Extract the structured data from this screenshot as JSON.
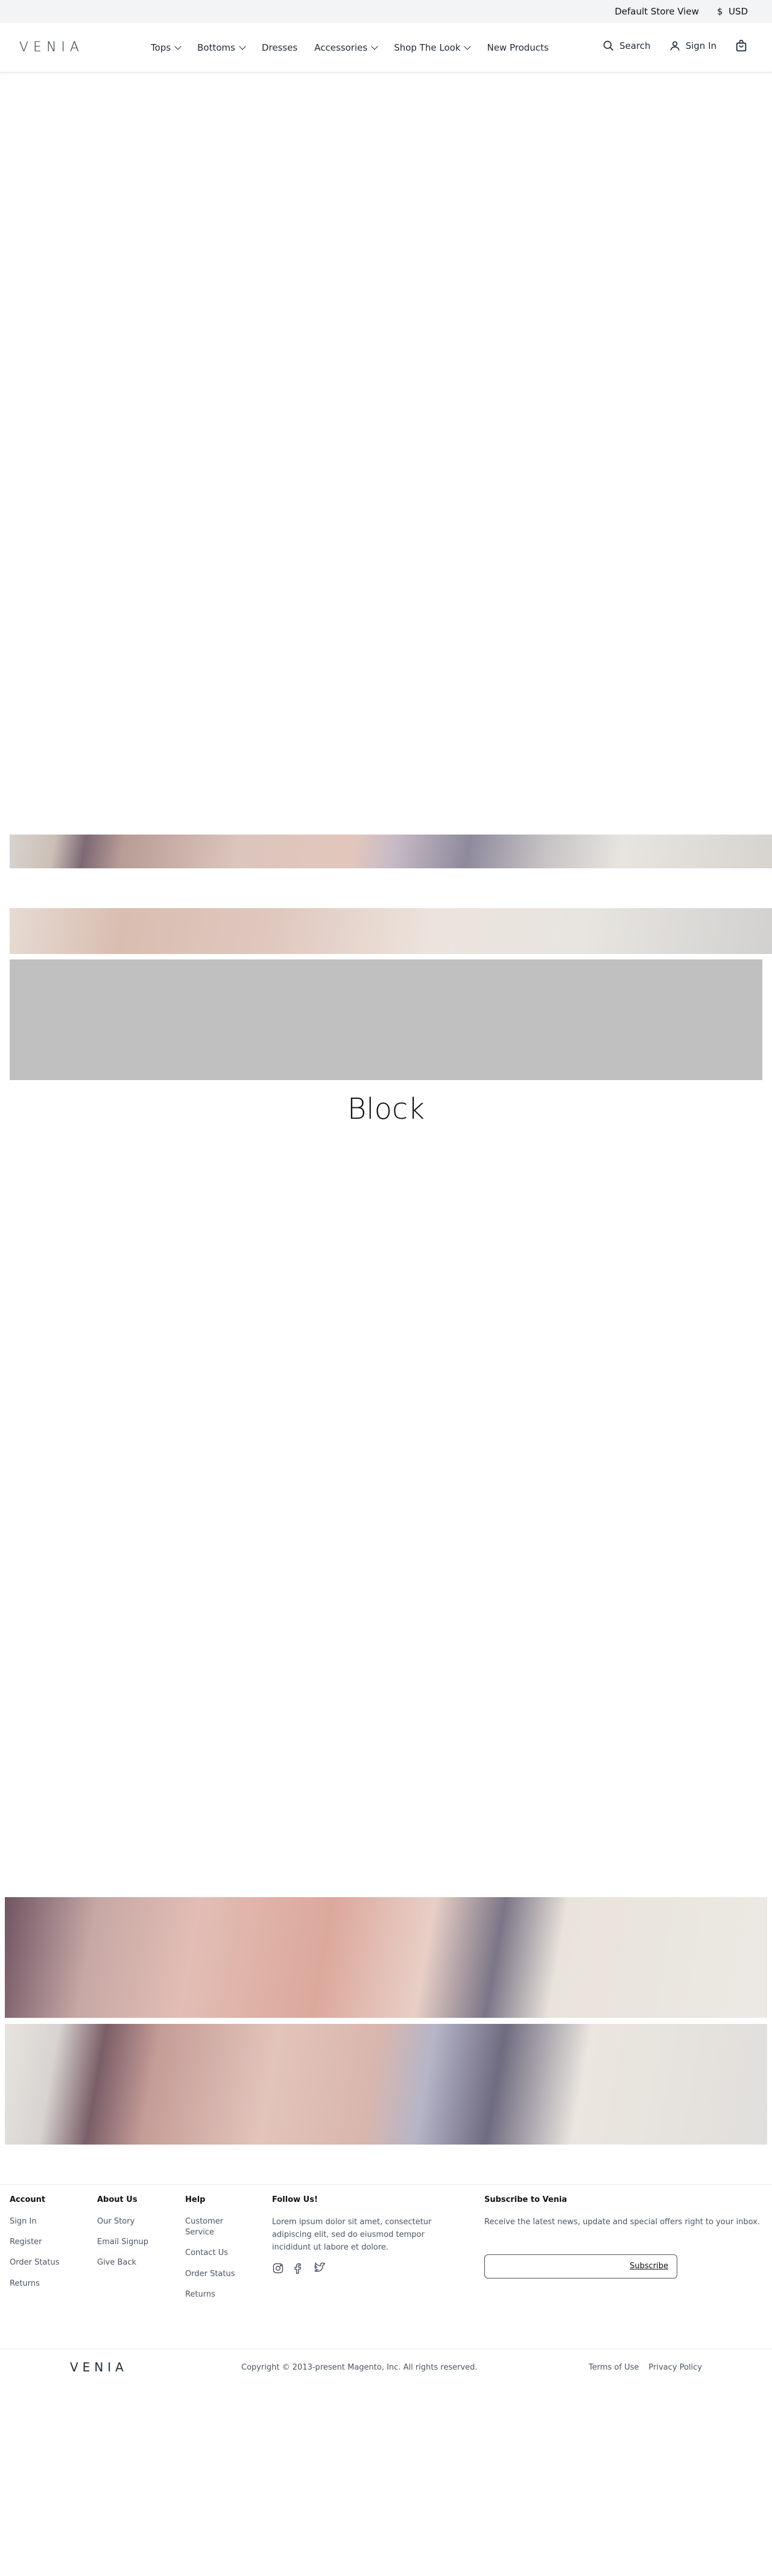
{
  "topbar": {
    "store_view": "Default Store View",
    "currency_symbol": "$",
    "currency": "USD"
  },
  "header": {
    "logo": "VENIA",
    "nav": [
      {
        "label": "Tops",
        "has_dropdown": true
      },
      {
        "label": "Bottoms",
        "has_dropdown": true
      },
      {
        "label": "Dresses",
        "has_dropdown": false
      },
      {
        "label": "Accessories",
        "has_dropdown": true
      },
      {
        "label": "Shop The Look",
        "has_dropdown": true
      },
      {
        "label": "New Products",
        "has_dropdown": false
      }
    ],
    "search_label": "Search",
    "signin_label": "Sign In",
    "cart_icon": "shopping-bag-icon"
  },
  "main": {
    "block_heading": "Block"
  },
  "footer": {
    "account": {
      "title": "Account",
      "links": [
        "Sign In",
        "Register",
        "Order Status",
        "Returns"
      ]
    },
    "about": {
      "title": "About Us",
      "links": [
        "Our Story",
        "Email Signup",
        "Give Back"
      ]
    },
    "help": {
      "title": "Help",
      "links": [
        "Customer Service",
        "Contact Us",
        "Order Status",
        "Returns"
      ]
    },
    "follow": {
      "title": "Follow Us!",
      "text": "Lorem ipsum dolor sit amet, consectetur adipiscing elit, sed do eiusmod tempor incididunt ut labore et dolore.",
      "icons": [
        "instagram-icon",
        "facebook-icon",
        "twitter-icon"
      ]
    },
    "subscribe": {
      "title": "Subscribe to Venia",
      "text": "Receive the latest news, update and special offers right to your inbox.",
      "input_placeholder": "",
      "button": "Subscribe"
    },
    "bottom": {
      "logo": "VENIA",
      "copyright": "Copyright © 2013-present Magento, Inc. All rights reserved.",
      "terms": "Terms of Use",
      "privacy": "Privacy Policy"
    }
  },
  "colors": {
    "topbar_bg": "#f3f4f6",
    "placeholder_grey": "#c0c0c0",
    "text": "#1f2937"
  }
}
